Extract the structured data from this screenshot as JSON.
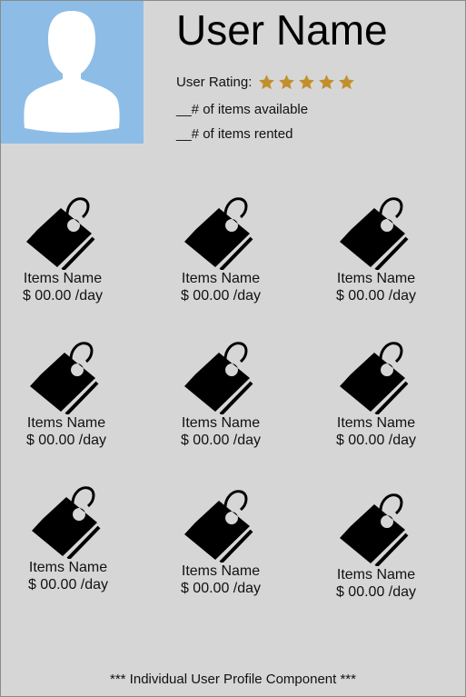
{
  "profile": {
    "avatar_icon": "user-silhouette-icon",
    "user_name": "User Name",
    "rating_label": "User Rating:",
    "rating_value": 5,
    "rating_max": 5,
    "star_icon": "star-icon",
    "star_color": "#c38f2c",
    "items_available": "__# of items available",
    "items_rented": "__# of items rented"
  },
  "items": [
    {
      "icon": "price-tag-icon",
      "name": "Items Name",
      "price": "$ 00.00 /day"
    },
    {
      "icon": "price-tag-icon",
      "name": "Items Name",
      "price": "$ 00.00 /day"
    },
    {
      "icon": "price-tag-icon",
      "name": "Items Name",
      "price": "$ 00.00 /day"
    },
    {
      "icon": "price-tag-icon",
      "name": "Items Name",
      "price": "$ 00.00 /day"
    },
    {
      "icon": "price-tag-icon",
      "name": "Items Name",
      "price": "$ 00.00 /day"
    },
    {
      "icon": "price-tag-icon",
      "name": "Items Name",
      "price": "$ 00.00 /day"
    },
    {
      "icon": "price-tag-icon",
      "name": "Items Name",
      "price": "$ 00.00 /day"
    },
    {
      "icon": "price-tag-icon",
      "name": "Items Name",
      "price": "$ 00.00 /day"
    },
    {
      "icon": "price-tag-icon",
      "name": "Items Name",
      "price": "$ 00.00 /day"
    }
  ],
  "footer": {
    "caption": "*** Individual User Profile Component ***"
  },
  "colors": {
    "background": "#d6d6d6",
    "avatar_background": "#8dbde6",
    "border": "#8a8a8a"
  }
}
